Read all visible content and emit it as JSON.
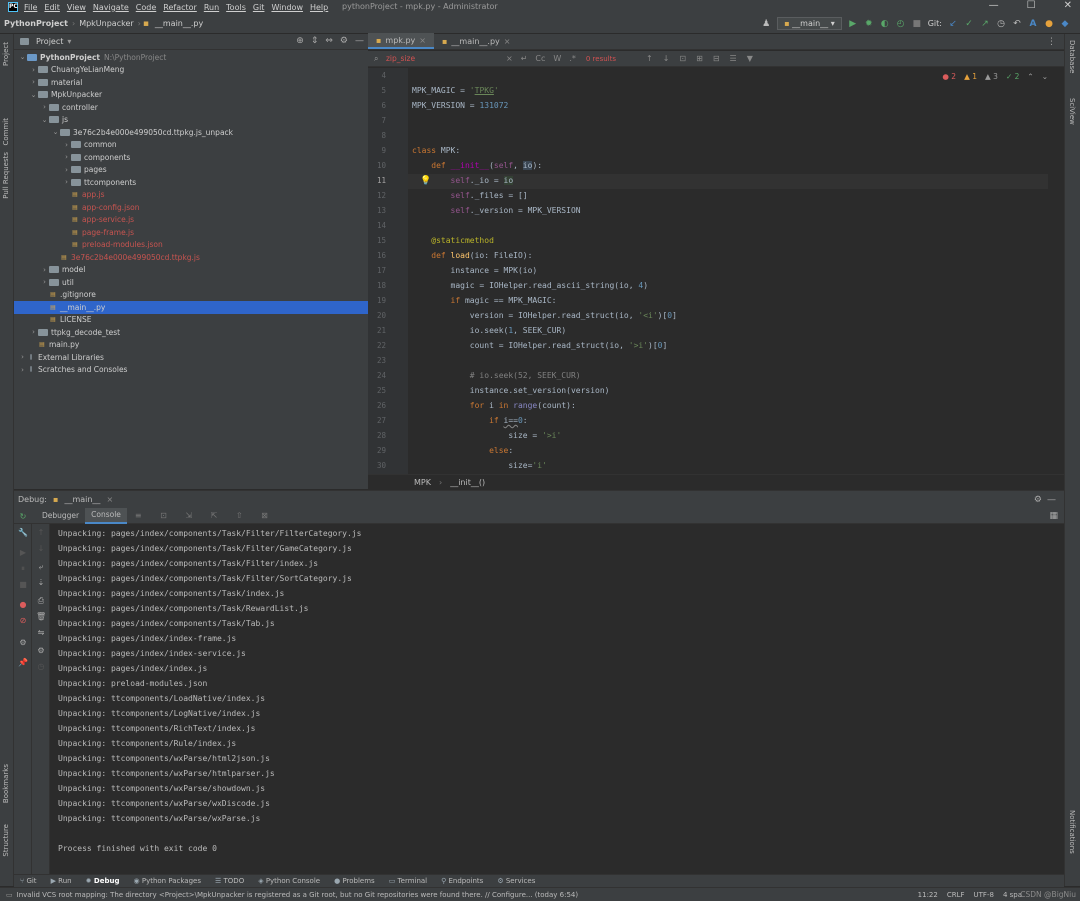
{
  "window": {
    "title": "pythonProject - mpk.py - Administrator",
    "menu": [
      "File",
      "Edit",
      "View",
      "Navigate",
      "Code",
      "Refactor",
      "Run",
      "Tools",
      "Git",
      "Window",
      "Help"
    ],
    "controls": [
      "—",
      "☐",
      "✕"
    ]
  },
  "navbar": {
    "crumbs": [
      "PythonProject",
      "MpkUnpacker",
      "__main__.py"
    ],
    "run_config": "__main__",
    "git_label": "Git:"
  },
  "left_strip": [
    "Project",
    "Commit",
    "Pull Requests",
    "Bookmarks",
    "Structure"
  ],
  "right_strip": [
    "Database",
    "SciView",
    "Notifications"
  ],
  "project_panel": {
    "title": "Project",
    "tree": [
      {
        "label": "PythonProject",
        "extra": "N:\\PythonProject",
        "indent": 0,
        "kind": "module",
        "expanded": true,
        "bold": true
      },
      {
        "label": "ChuangYeLianMeng",
        "indent": 1,
        "kind": "folder",
        "expanded": false
      },
      {
        "label": "material",
        "indent": 1,
        "kind": "folder",
        "expanded": false
      },
      {
        "label": "MpkUnpacker",
        "indent": 1,
        "kind": "folder",
        "expanded": true
      },
      {
        "label": "controller",
        "indent": 2,
        "kind": "folder",
        "expanded": false
      },
      {
        "label": "js",
        "indent": 2,
        "kind": "folder",
        "expanded": true
      },
      {
        "label": "3e76c2b4e000e499050cd.ttpkg.js_unpack",
        "indent": 3,
        "kind": "folder",
        "expanded": true
      },
      {
        "label": "common",
        "indent": 4,
        "kind": "folder",
        "expanded": false
      },
      {
        "label": "components",
        "indent": 4,
        "kind": "folder",
        "expanded": false
      },
      {
        "label": "pages",
        "indent": 4,
        "kind": "folder",
        "expanded": false
      },
      {
        "label": "ttcomponents",
        "indent": 4,
        "kind": "folder",
        "expanded": false
      },
      {
        "label": "app.js",
        "indent": 4,
        "kind": "file",
        "red": true
      },
      {
        "label": "app-config.json",
        "indent": 4,
        "kind": "file",
        "red": true
      },
      {
        "label": "app-service.js",
        "indent": 4,
        "kind": "file",
        "red": true
      },
      {
        "label": "page-frame.js",
        "indent": 4,
        "kind": "file",
        "red": true
      },
      {
        "label": "preload-modules.json",
        "indent": 4,
        "kind": "file",
        "red": true
      },
      {
        "label": "3e76c2b4e000e499050cd.ttpkg.js",
        "indent": 3,
        "kind": "file",
        "red": true
      },
      {
        "label": "model",
        "indent": 2,
        "kind": "folder",
        "expanded": false
      },
      {
        "label": "util",
        "indent": 2,
        "kind": "folder",
        "expanded": false
      },
      {
        "label": ".gitignore",
        "indent": 2,
        "kind": "file"
      },
      {
        "label": "__main__.py",
        "indent": 2,
        "kind": "file",
        "selected": true
      },
      {
        "label": "LICENSE",
        "indent": 2,
        "kind": "file"
      },
      {
        "label": "ttpkg_decode_test",
        "indent": 1,
        "kind": "folder",
        "expanded": false
      },
      {
        "label": "main.py",
        "indent": 1,
        "kind": "file"
      },
      {
        "label": "External Libraries",
        "indent": 0,
        "kind": "lib",
        "expanded": false
      },
      {
        "label": "Scratches and Consoles",
        "indent": 0,
        "kind": "lib",
        "expanded": false
      }
    ]
  },
  "editor": {
    "tabs": [
      {
        "label": "mpk.py",
        "active": true
      },
      {
        "label": "__main__.py",
        "active": false
      }
    ],
    "find": {
      "query": "zip_size",
      "results": "0 results",
      "cc": "Cc",
      "w": "W"
    },
    "inspections": {
      "errors": "2",
      "warnings": "1",
      "weak": "3",
      "ok": "2"
    },
    "line_numbers": [
      "4",
      "5",
      "6",
      "7",
      "8",
      "9",
      "10",
      "11",
      "12",
      "13",
      "14",
      "15",
      "16",
      "17",
      "18",
      "19",
      "20",
      "21",
      "22",
      "23",
      "24",
      "25",
      "26",
      "27",
      "28",
      "29",
      "30"
    ],
    "current_line": "11",
    "breadcrumb": [
      "MPK",
      "__init__()"
    ]
  },
  "debug": {
    "title": "Debug:",
    "session": "__main__",
    "tabs": [
      "Debugger",
      "Console"
    ],
    "console_lines": [
      "Unpacking: pages/index/components/Task/Filter/FilterCategory.js",
      "Unpacking: pages/index/components/Task/Filter/GameCategory.js",
      "Unpacking: pages/index/components/Task/Filter/index.js",
      "Unpacking: pages/index/components/Task/Filter/SortCategory.js",
      "Unpacking: pages/index/components/Task/index.js",
      "Unpacking: pages/index/components/Task/RewardList.js",
      "Unpacking: pages/index/components/Task/Tab.js",
      "Unpacking: pages/index/index-frame.js",
      "Unpacking: pages/index/index-service.js",
      "Unpacking: pages/index/index.js",
      "Unpacking: preload-modules.json",
      "Unpacking: ttcomponents/LoadNative/index.js",
      "Unpacking: ttcomponents/LogNative/index.js",
      "Unpacking: ttcomponents/RichText/index.js",
      "Unpacking: ttcomponents/Rule/index.js",
      "Unpacking: ttcomponents/wxParse/html2json.js",
      "Unpacking: ttcomponents/wxParse/htmlparser.js",
      "Unpacking: ttcomponents/wxParse/showdown.js",
      "Unpacking: ttcomponents/wxParse/wxDiscode.js",
      "Unpacking: ttcomponents/wxParse/wxParse.js",
      "",
      "Process finished with exit code 0"
    ]
  },
  "bottom_tools": [
    "Git",
    "Run",
    "Debug",
    "Python Packages",
    "TODO",
    "Python Console",
    "Problems",
    "Terminal",
    "Endpoints",
    "Services"
  ],
  "status": {
    "message": "Invalid VCS root mapping: The directory <Project>\\MpkUnpacker is registered as a Git root, but no Git repositories were found there. // Configure... (today 6:54)",
    "position": "11:22",
    "line_sep": "CRLF",
    "encoding": "UTF-8",
    "indent": "4 spa",
    "watermark": "CSDN @BigNiu"
  }
}
